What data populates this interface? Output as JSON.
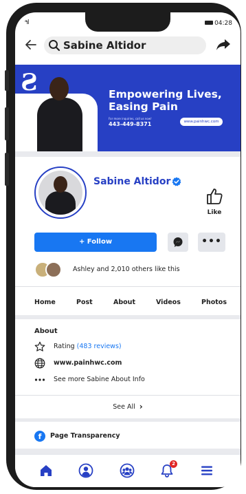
{
  "status_bar": {
    "signal": "ᵃıl",
    "time": "04:28"
  },
  "header": {
    "search_value": "Sabine Altidor"
  },
  "banner": {
    "headline": "Empowering Lives, Easing Pain",
    "small_text": "For more inquiries, call us now!",
    "phone": "443-449-8371",
    "url": "www.painhwc.com",
    "accent_color": "#2740c4"
  },
  "profile": {
    "name": "Sabine Altidor",
    "verified": true,
    "like_label": "Like",
    "follow_label": "+ Follow",
    "more_label": "•••",
    "friends_text": "Ashley and 2,010 others like this"
  },
  "tabs": [
    "Home",
    "Post",
    "About",
    "Videos",
    "Photos"
  ],
  "about": {
    "title": "About",
    "rating_label": "Rating",
    "rating_reviews": "(483 reviews)",
    "website": "www.painhwc.com",
    "see_more": "See more Sabine About Info"
  },
  "see_all_label": "See All",
  "transparency_label": "Page Transparency",
  "bottom_nav": {
    "items": [
      "home-icon",
      "profile-icon",
      "groups-icon",
      "notifications-icon",
      "menu-icon"
    ],
    "notification_count": "2",
    "active_color": "#2740c4"
  },
  "colors": {
    "brand_blue": "#1877f2",
    "dark_blue": "#2740c4"
  }
}
